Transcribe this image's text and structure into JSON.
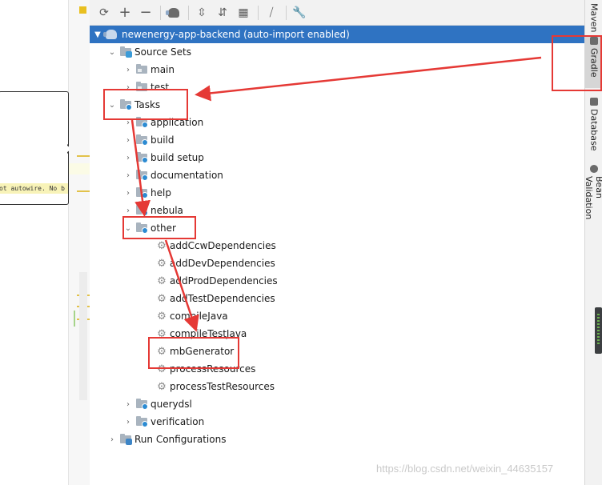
{
  "toolbar": {
    "buttons": [
      "refresh-icon",
      "plus-icon",
      "minus-icon",
      "gradle-icon",
      "expand-all-icon",
      "collapse-all-icon",
      "group-modules-icon",
      "toggle-offline-icon",
      "settings-wrench-icon"
    ]
  },
  "editor": {
    "warning_text": "ot autowire. No b"
  },
  "tree": {
    "project": "newenergy-app-backend (auto-import enabled)",
    "source_sets": "Source Sets",
    "main": "main",
    "test": "test",
    "tasks": "Tasks",
    "application": "application",
    "build": "build",
    "build_setup": "build setup",
    "documentation": "documentation",
    "help": "help",
    "nebula": "nebula",
    "other": "other",
    "addCcw": "addCcwDependencies",
    "addDev": "addDevDependencies",
    "addProd": "addProdDependencies",
    "addTest": "addTestDependencies",
    "compileJava": "compileJava",
    "compileTestJava": "compileTestJava",
    "mbGenerator": "mbGenerator",
    "processResources": "processResources",
    "processTestResources": "processTestResources",
    "querydsl": "querydsl",
    "verification": "verification",
    "run_configs": "Run Configurations"
  },
  "sidebar": {
    "maven": "Maven",
    "gradle": "Gradle",
    "database": "Database",
    "bean_validation": "Bean Validation"
  },
  "watermark": "https://blog.csdn.net/weixin_44635157",
  "colors": {
    "selection": "#2f73c2",
    "annotation": "#e53935",
    "task_badge": "#2c8bd2"
  }
}
